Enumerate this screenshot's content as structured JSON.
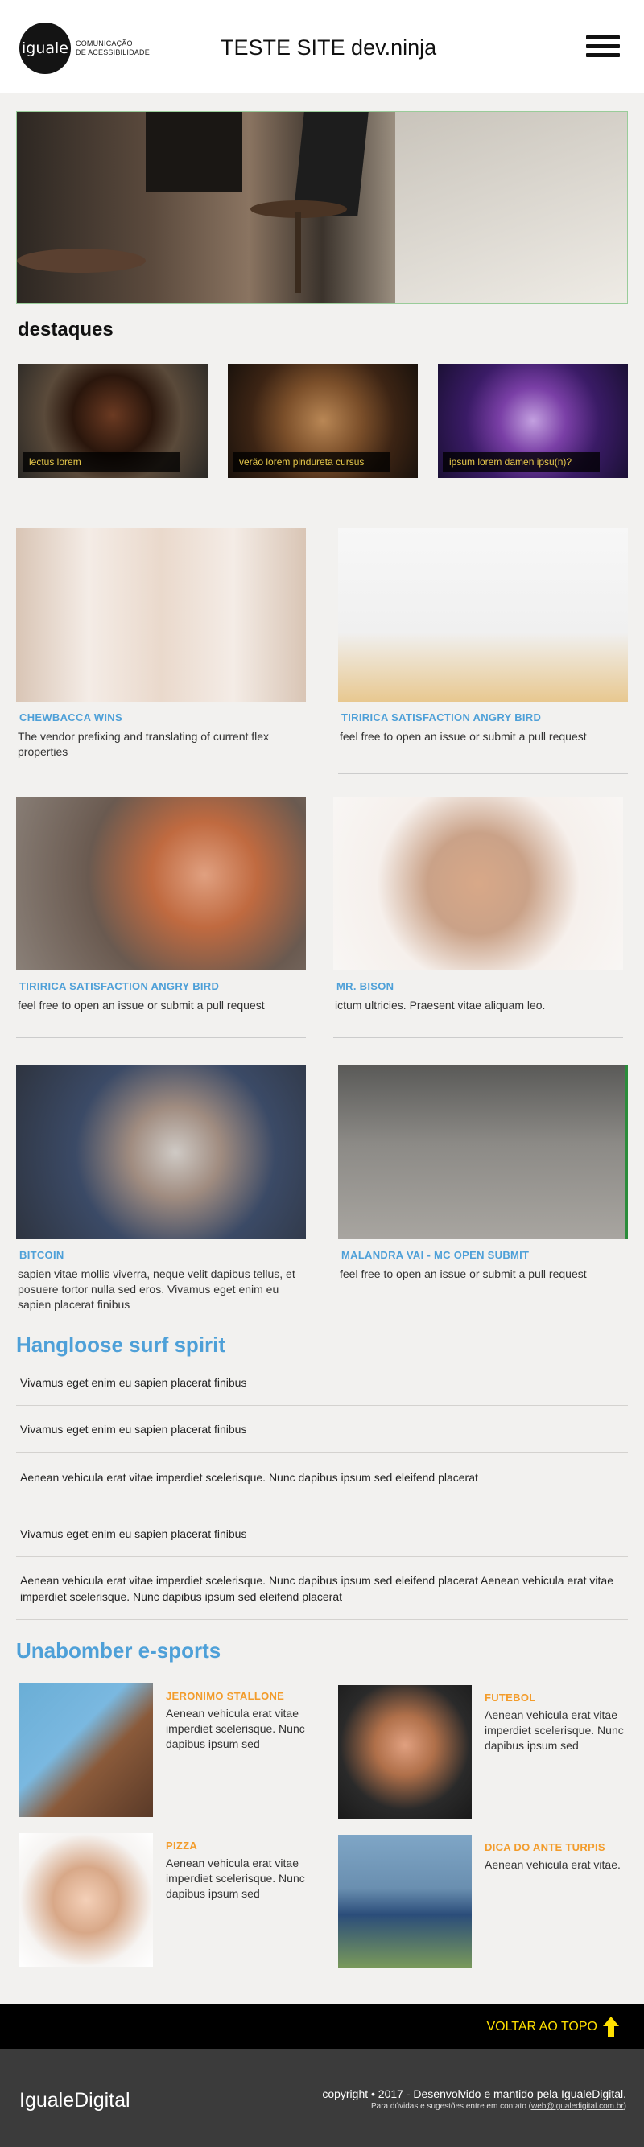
{
  "header": {
    "logo_text": "iguale",
    "logo_tagline_1": "COMUNICAÇÃO",
    "logo_tagline_2": "DE ACESSIBILIDADE",
    "title_main": "TESTE SITE",
    "title_suffix": "dev.ninja",
    "menu_icon": "hamburger-menu-icon"
  },
  "destaques": {
    "heading": "destaques",
    "items": [
      {
        "caption": "lectus lorem"
      },
      {
        "caption": "verão lorem pindureta cursus"
      },
      {
        "caption": "ipsum lorem damen ipsu(n)?"
      }
    ]
  },
  "cards": [
    {
      "category": "CHEWBACCA WINS",
      "text": "The vendor prefixing and translating of current flex properties"
    },
    {
      "category": "TIRIRICA SATISFACTION ANGRY BIRD",
      "text": "feel free to open an issue or submit a pull request"
    },
    {
      "category": "TIRIRICA SATISFACTION ANGRY BIRD",
      "text": "feel free to open an issue or submit a pull request"
    },
    {
      "category": "MR. BISON",
      "text": "ictum ultricies. Praesent vitae aliquam leo."
    },
    {
      "category": "BITCOIN",
      "text": "sapien vitae mollis viverra, neque velit dapibus tellus, et posuere tortor nulla sed eros. Vivamus eget enim eu sapien placerat finibus"
    },
    {
      "category": "MALANDRA VAI - MC OPEN SUBMIT",
      "text": "feel free to open an issue or submit a pull request"
    }
  ],
  "hangloose": {
    "heading": "Hangloose surf spirit",
    "items": [
      "Vivamus eget enim eu sapien placerat finibus",
      "Vivamus eget enim eu sapien placerat finibus",
      "Aenean vehicula erat vitae imperdiet scelerisque. Nunc dapibus ipsum sed eleifend placerat",
      "Vivamus eget enim eu sapien placerat finibus",
      "Aenean vehicula erat vitae imperdiet scelerisque. Nunc dapibus ipsum sed eleifend placerat Aenean vehicula erat vitae imperdiet scelerisque. Nunc dapibus ipsum sed eleifend placerat"
    ]
  },
  "unabomber": {
    "heading": "Unabomber e-sports",
    "people": [
      {
        "name": "JERONIMO STALLONE",
        "text": "Aenean vehicula erat vitae imperdiet scelerisque. Nunc dapibus ipsum sed"
      },
      {
        "name": "FUTEBOL",
        "text": "Aenean vehicula erat vitae imperdiet scelerisque. Nunc dapibus ipsum sed"
      },
      {
        "name": "PIZZA",
        "text": "Aenean vehicula erat vitae imperdiet scelerisque. Nunc dapibus ipsum sed"
      },
      {
        "name": "DICA DO ANTE TURPIS",
        "text": "Aenean vehicula erat vitae."
      }
    ]
  },
  "footer": {
    "back_to_top": "VOLTAR AO TOPO",
    "brand": "IgualeDigital",
    "copyright": "copyright • 2017 - Desenvolvido e mantido pela IgualeDigital.",
    "contact_prefix": "Para dúvidas e sugestões entre em contato (",
    "contact_email": "web@igualedigital.com.br",
    "contact_suffix": ")"
  },
  "colors": {
    "accent_blue": "#4ea0d8",
    "accent_orange": "#f39c2b",
    "back_to_top_yellow": "#ffe000",
    "background": "#f2f1ef"
  }
}
